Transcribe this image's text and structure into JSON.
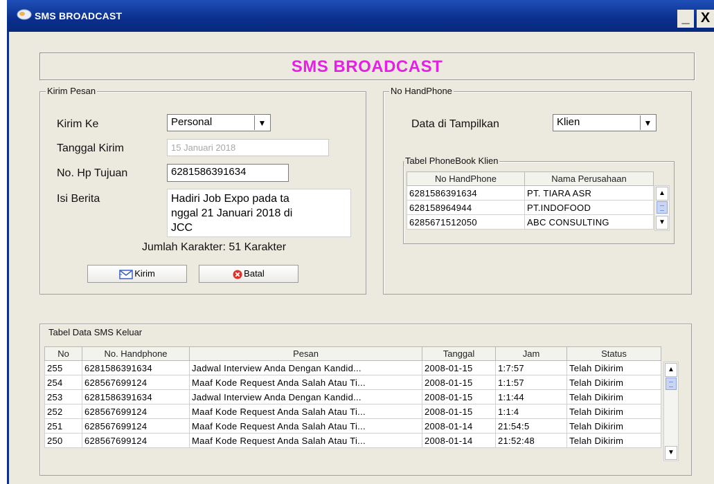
{
  "window": {
    "title": "SMS BROADCAST",
    "minimize_label": "_",
    "close_label": "X"
  },
  "header": {
    "title": "SMS BROADCAST"
  },
  "kirim_pesan": {
    "group_label": "Kirim Pesan",
    "kirim_ke_label": "Kirim Ke",
    "kirim_ke_value": "Personal",
    "tanggal_label": "Tanggal Kirim",
    "tanggal_value": "15 Januari 2018",
    "hp_label": "No. Hp Tujuan",
    "hp_value": "6281586391634",
    "isi_label": "Isi Berita",
    "isi_lines": [
      "Hadiri Job Expo pada ta",
      "nggal 21 Januari 2018 di",
      "JCC"
    ],
    "jumlah_karakter": "Jumlah Karakter: 51 Karakter",
    "kirim_button": "Kirim",
    "batal_button": "Batal"
  },
  "no_handphone": {
    "group_label": "No HandPhone",
    "data_label": "Data di Tampilkan",
    "data_value": "Klien",
    "table_label": "Tabel PhoneBook Klien",
    "columns": [
      "No HandPhone",
      "Nama Perusahaan"
    ],
    "rows": [
      [
        "6281586391634",
        "PT. TIARA ASR"
      ],
      [
        "628158964944",
        "PT.INDOFOOD"
      ],
      [
        "6285671512050",
        "ABC CONSULTING"
      ]
    ]
  },
  "sms_keluar": {
    "table_label": "Tabel Data SMS Keluar",
    "columns": [
      "No",
      "No. Handphone",
      "Pesan",
      "Tanggal",
      "Jam",
      "Status"
    ],
    "rows": [
      [
        "255",
        "6281586391634",
        "Jadwal Interview Anda Dengan Kandid...",
        "2008-01-15",
        "1:7:57",
        "Telah Dikirim"
      ],
      [
        "254",
        "628567699124",
        "Maaf Kode Request Anda Salah Atau Ti...",
        "2008-01-15",
        "1:1:57",
        "Telah Dikirim"
      ],
      [
        "253",
        "6281586391634",
        "Jadwal Interview Anda Dengan Kandid...",
        "2008-01-15",
        "1:1:44",
        "Telah Dikirim"
      ],
      [
        "252",
        "628567699124",
        "Maaf Kode Request Anda Salah Atau Ti...",
        "2008-01-15",
        "1:1:4",
        "Telah Dikirim"
      ],
      [
        "251",
        "628567699124",
        "Maaf Kode Request Anda Salah Atau Ti...",
        "2008-01-14",
        "21:54:5",
        "Telah Dikirim"
      ],
      [
        "250",
        "628567699124",
        "Maaf Kode Request Anda Salah Atau Ti...",
        "2008-01-14",
        "21:52:48",
        "Telah Dikirim"
      ]
    ]
  },
  "colors": {
    "title_bar": "#0a2f8c",
    "header_title": "#e81ee8",
    "window_bg": "#eceadf"
  }
}
